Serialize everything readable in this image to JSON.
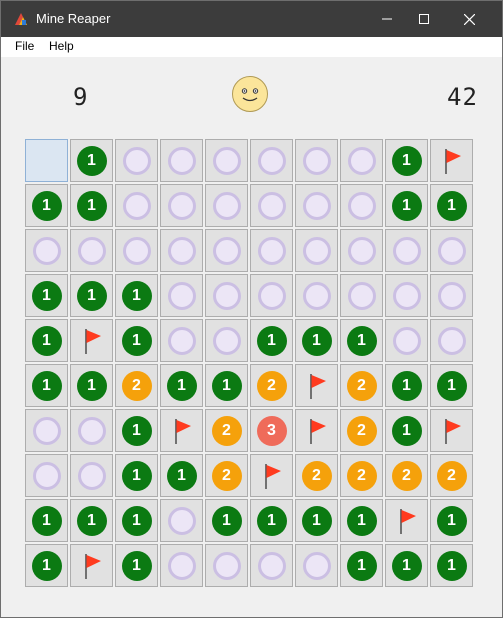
{
  "window": {
    "title": "Mine Reaper"
  },
  "menu": {
    "file": "File",
    "help": "Help"
  },
  "status": {
    "mines_left": "9",
    "time": "42",
    "face": "smiley-face"
  },
  "colors": {
    "one": "#0b7a12",
    "two": "#f5a10b",
    "three": "#ef6b5a",
    "flag": "#ff3b1f"
  },
  "board": [
    [
      "e",
      "1",
      "h",
      "h",
      "h",
      "h",
      "h",
      "h",
      "1",
      "f"
    ],
    [
      "1",
      "1",
      "h",
      "h",
      "h",
      "h",
      "h",
      "h",
      "1",
      "1"
    ],
    [
      "h",
      "h",
      "h",
      "h",
      "h",
      "h",
      "h",
      "h",
      "h",
      "h"
    ],
    [
      "1",
      "1",
      "1",
      "h",
      "h",
      "h",
      "h",
      "h",
      "h",
      "h"
    ],
    [
      "1",
      "f",
      "1",
      "h",
      "h",
      "1",
      "1",
      "1",
      "h",
      "h"
    ],
    [
      "1",
      "1",
      "2",
      "1",
      "1",
      "2",
      "f",
      "2",
      "1",
      "1"
    ],
    [
      "h",
      "h",
      "1",
      "f",
      "2",
      "3",
      "f",
      "2",
      "1",
      "f"
    ],
    [
      "h",
      "h",
      "1",
      "1",
      "2",
      "f",
      "2",
      "2",
      "2",
      "2"
    ],
    [
      "1",
      "1",
      "1",
      "h",
      "1",
      "1",
      "1",
      "1",
      "f",
      "1"
    ],
    [
      "1",
      "f",
      "1",
      "h",
      "h",
      "h",
      "h",
      "1",
      "1",
      "1"
    ]
  ]
}
